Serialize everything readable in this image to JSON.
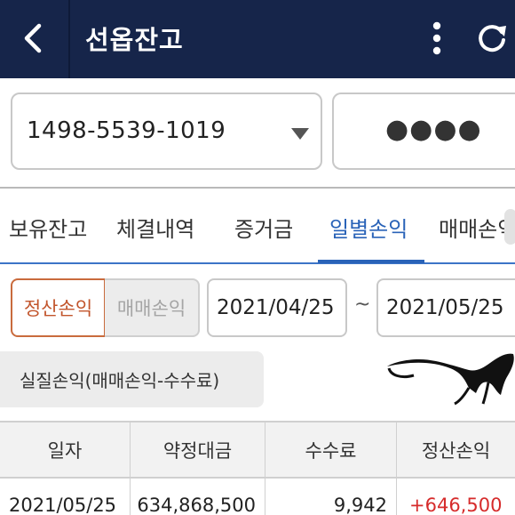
{
  "header": {
    "title": "선옵잔고",
    "background_color": "#16254a",
    "icons": {
      "back": "chevron-left-icon",
      "menu": "more-vertical-icon",
      "refresh": "refresh-icon"
    }
  },
  "account": {
    "number": "1498-5539-1019",
    "password_mask": "●●●●"
  },
  "tabs": [
    {
      "label": "보유잔고",
      "active": false
    },
    {
      "label": "체결내역",
      "active": false
    },
    {
      "label": "증거금",
      "active": false
    },
    {
      "label": "일별손익",
      "active": true
    },
    {
      "label": "매매손익",
      "active": false
    }
  ],
  "filter": {
    "segments": [
      {
        "label": "정산손익",
        "selected": true
      },
      {
        "label": "매매손익",
        "selected": false
      }
    ],
    "date_from": "2021/04/25",
    "date_separator": "~",
    "date_to": "2021/05/25"
  },
  "summary": {
    "label": "실질손익(매매손익-수수료)"
  },
  "table": {
    "columns": [
      "일자",
      "약정대금",
      "수수료",
      "정산손익"
    ],
    "rows": [
      {
        "date": "2021/05/25",
        "volume": "634,868,500",
        "fee": "9,942",
        "settle_pnl": "+646,500"
      }
    ]
  },
  "colors": {
    "accent": "#2a63b8",
    "segment_selected": "#c2552c",
    "profit": "#d62b2b"
  }
}
